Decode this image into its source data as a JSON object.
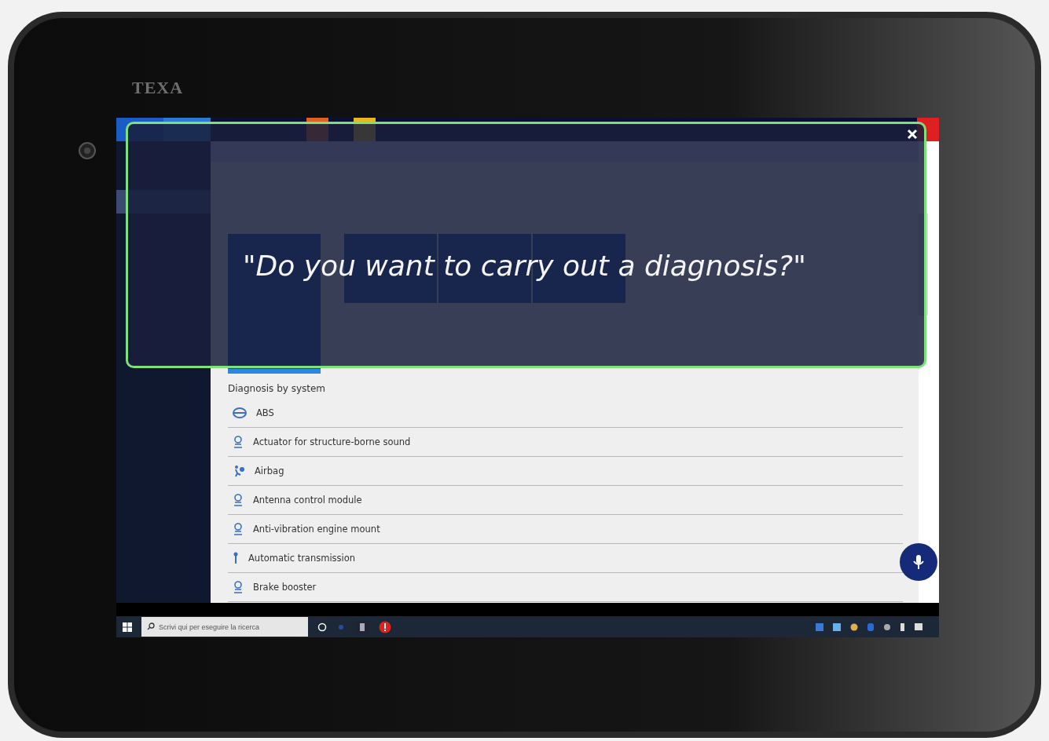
{
  "device": {
    "brand": "TEXA"
  },
  "overlay": {
    "prompt": "\"Do you want to carry out a diagnosis?\""
  },
  "section_title": "Diagnosis by system",
  "systems": [
    {
      "name": "ABS",
      "kind": "disc"
    },
    {
      "name": "Actuator for structure-borne sound",
      "kind": "module"
    },
    {
      "name": "Airbag",
      "kind": "airbag"
    },
    {
      "name": "Antenna control module",
      "kind": "module"
    },
    {
      "name": "Anti-vibration engine mount",
      "kind": "module"
    },
    {
      "name": "Automatic transmission",
      "kind": "shifter"
    },
    {
      "name": "Brake booster",
      "kind": "module"
    }
  ],
  "taskbar": {
    "search": {
      "placeholder": "Scrivi qui per eseguire la ricerca"
    }
  }
}
